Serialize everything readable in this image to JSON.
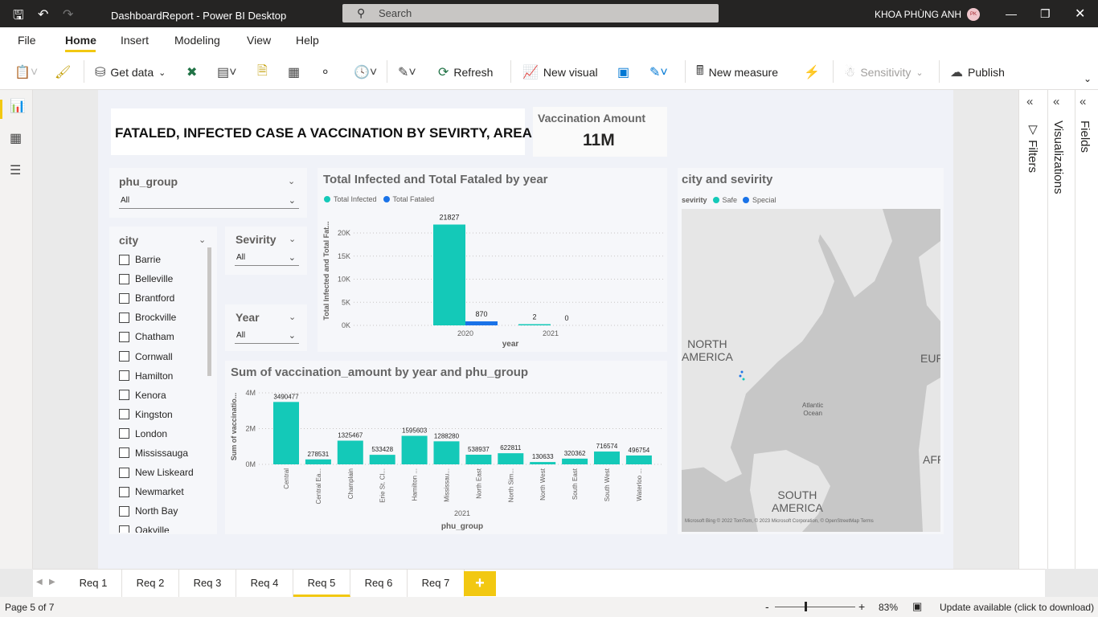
{
  "titlebar": {
    "doc_title": "DashboardReport - Power BI Desktop",
    "search_placeholder": "Search",
    "user": "KHOA PHÙNG ANH",
    "avatar_initials": "PK"
  },
  "menu": {
    "file": "File",
    "home": "Home",
    "insert": "Insert",
    "modeling": "Modeling",
    "view": "View",
    "help": "Help"
  },
  "ribbon": {
    "get_data": "Get data",
    "refresh": "Refresh",
    "new_visual": "New visual",
    "new_measure": "New measure",
    "sensitivity": "Sensitivity",
    "publish": "Publish"
  },
  "report": {
    "title": "FATALED, INFECTED CASE A VACCINATION BY SEVIRTY, AREA",
    "vaccination_card": {
      "label": "Vaccination Amount",
      "value": "11M"
    },
    "phu_slicer": {
      "title": "phu_group",
      "value": "All"
    },
    "city_slicer": {
      "title": "city",
      "items": [
        "Barrie",
        "Belleville",
        "Brantford",
        "Brockville",
        "Chatham",
        "Cornwall",
        "Hamilton",
        "Kenora",
        "Kingston",
        "London",
        "Mississauga",
        "New Liskeard",
        "Newmarket",
        "North Bay",
        "Oakville"
      ]
    },
    "sevirity_slicer": {
      "title": "Sevirity",
      "value": "All"
    },
    "year_slicer": {
      "title": "Year",
      "value": "All"
    },
    "map": {
      "title": "city and sevirity",
      "legend_title": "sevirity",
      "legend": [
        "Safe",
        "Special"
      ],
      "labels": {
        "north_america": "NORTH\nAMERICA",
        "south_america": "SOUTH\nAMERICA",
        "europe": "EUR",
        "africa": "AFR",
        "ocean": "Atlantic\nOcean"
      },
      "attribution": "Microsoft Bing   © 2022 TomTom, © 2023 Microsoft Corporation, © OpenStreetMap  Terms"
    }
  },
  "chart_data": [
    {
      "type": "bar",
      "title": "Total Infected and Total Fataled by year",
      "xlabel": "year",
      "ylabel": "Total Infected and Total Fat...",
      "categories": [
        "2020",
        "2021"
      ],
      "series": [
        {
          "name": "Total Infected",
          "values": [
            21827,
            2
          ],
          "color": "#14c9b8"
        },
        {
          "name": "Total Fataled",
          "values": [
            870,
            0
          ],
          "color": "#1a73e8"
        }
      ],
      "ylim": [
        0,
        24000
      ],
      "yticks": [
        "0K",
        "5K",
        "10K",
        "15K",
        "20K"
      ],
      "legend": "top-left"
    },
    {
      "type": "bar",
      "title": "Sum of vaccination_amount by year and phu_group",
      "xlabel": "phu_group",
      "ylabel": "Sum of vaccinatio...",
      "group_label": "2021",
      "categories": [
        "Central",
        "Central Ea...",
        "Champlain",
        "Erie St. Cl...",
        "Hamilton ...",
        "Mississau...",
        "North East",
        "North Sim...",
        "North West",
        "South East",
        "South West",
        "Waterloo ..."
      ],
      "values": [
        3490477,
        278531,
        1325467,
        533428,
        1595603,
        1288280,
        538937,
        622811,
        130633,
        320362,
        716574,
        496754
      ],
      "color": "#14c9b8",
      "ylim": [
        0,
        4000000
      ],
      "yticks": [
        "0M",
        "2M",
        "4M"
      ]
    }
  ],
  "tabs": [
    "Req 1",
    "Req 2",
    "Req 3",
    "Req 4",
    "Req 5",
    "Req 6",
    "Req 7"
  ],
  "panes": {
    "filters": "Filters",
    "visualizations": "Visualizations",
    "fields": "Fields"
  },
  "status": {
    "page": "Page 5 of 7",
    "zoom": "83%",
    "update": "Update available (click to download)"
  }
}
